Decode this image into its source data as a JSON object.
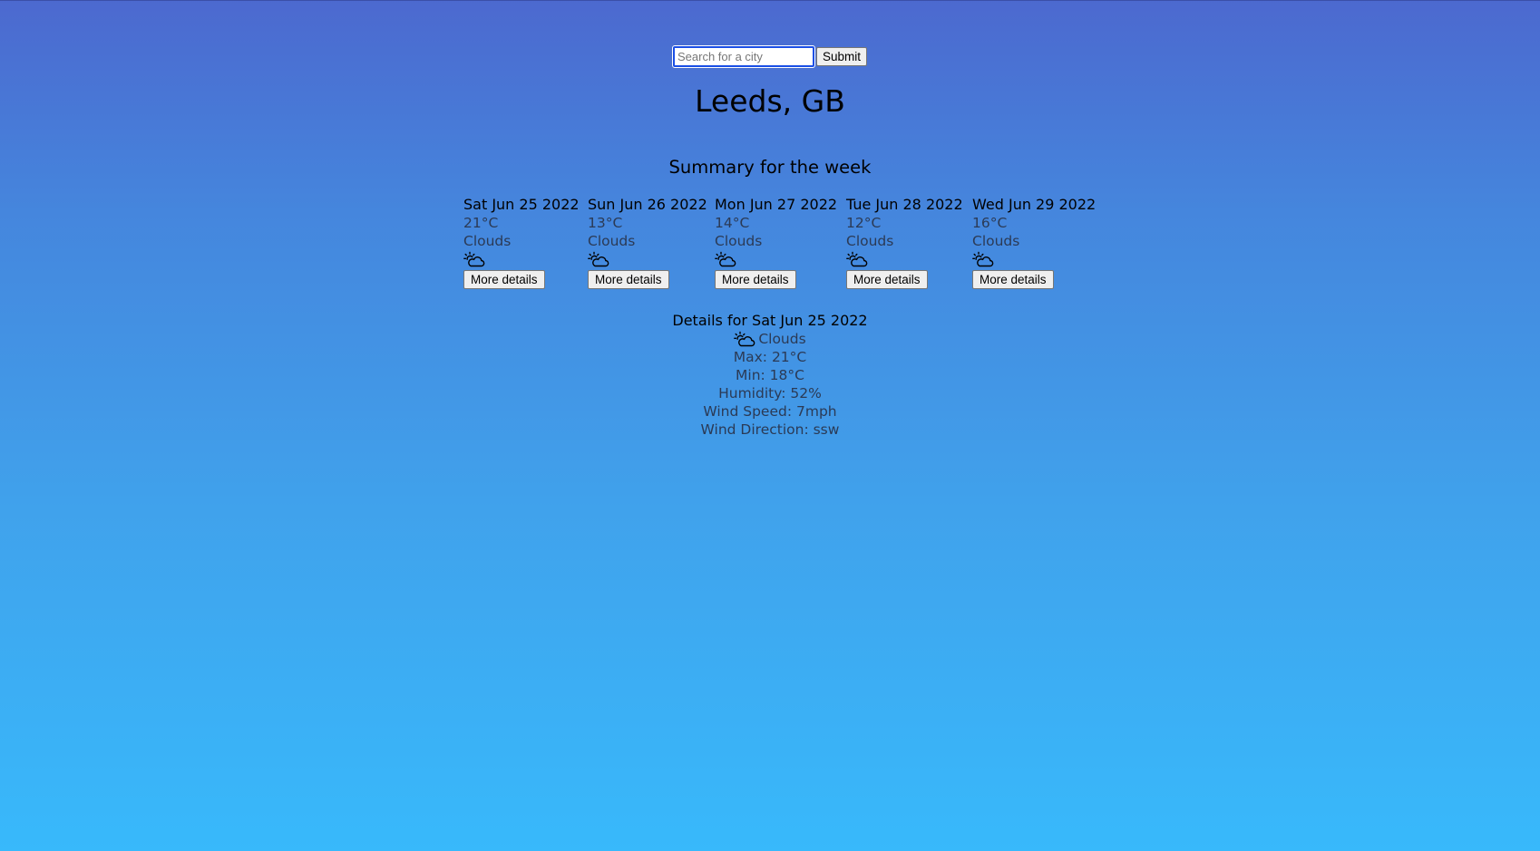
{
  "search": {
    "placeholder": "Search for a city",
    "value": "",
    "submit_label": "Submit"
  },
  "location": {
    "title": "Leeds, GB"
  },
  "summary": {
    "title": "Summary for the week",
    "days": [
      {
        "date": "Sat Jun 25 2022",
        "temp": "21°C",
        "condition": "Clouds",
        "icon": "partly-cloudy-icon",
        "button_label": "More details"
      },
      {
        "date": "Sun Jun 26 2022",
        "temp": "13°C",
        "condition": "Clouds",
        "icon": "partly-cloudy-icon",
        "button_label": "More details"
      },
      {
        "date": "Mon Jun 27 2022",
        "temp": "14°C",
        "condition": "Clouds",
        "icon": "partly-cloudy-icon",
        "button_label": "More details"
      },
      {
        "date": "Tue Jun 28 2022",
        "temp": "12°C",
        "condition": "Clouds",
        "icon": "partly-cloudy-icon",
        "button_label": "More details"
      },
      {
        "date": "Wed Jun 29 2022",
        "temp": "16°C",
        "condition": "Clouds",
        "icon": "partly-cloudy-icon",
        "button_label": "More details"
      }
    ]
  },
  "details": {
    "title": "Details for Sat Jun 25 2022",
    "condition": "Clouds",
    "icon": "partly-cloudy-icon",
    "max": "Max: 21°C",
    "min": "Min: 18°C",
    "humidity": "Humidity: 52%",
    "wind_speed": "Wind Speed: 7mph",
    "wind_direction": "Wind Direction: ssw"
  },
  "colors": {
    "background_top": "#4c69cf",
    "background_bottom": "#38b9fb",
    "secondary_text": "#2b3a55",
    "input_focus_border": "#1a4fe6"
  }
}
